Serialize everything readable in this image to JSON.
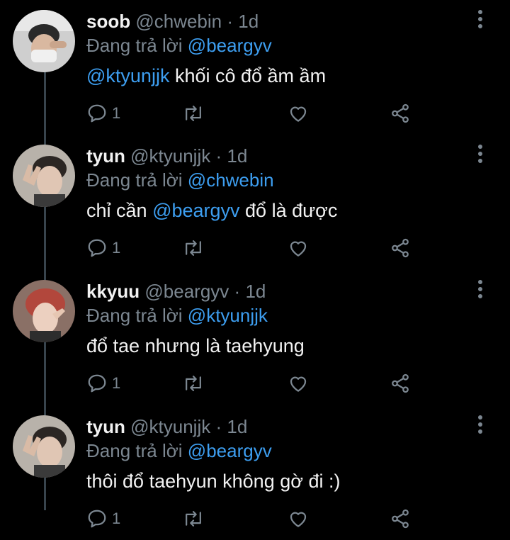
{
  "reply_prefix": "Đang trả lời",
  "colors": {
    "background": "#000000",
    "text": "#f2f2f2",
    "muted": "#7c8791",
    "mention": "#3d9ef0",
    "thread_line": "#38444d"
  },
  "action_icons": [
    "reply-icon",
    "retweet-icon",
    "like-icon",
    "share-icon"
  ],
  "tweets": [
    {
      "name": "soob",
      "handle": "@chwebin",
      "separator": "·",
      "time": "1d",
      "reply_to": "@beargyv",
      "text_parts": [
        "@ktyunjjk",
        " khối cô đổ ầm ầm"
      ],
      "reply_count": "1"
    },
    {
      "name": "tyun",
      "handle": "@ktyunjjk",
      "separator": "·",
      "time": "1d",
      "reply_to": "@chwebin",
      "text_parts": [
        "chỉ cần ",
        "@beargyv",
        " đổ là được"
      ],
      "reply_count": "1"
    },
    {
      "name": "kkyuu",
      "handle": "@beargyv",
      "separator": "·",
      "time": "1d",
      "reply_to": "@ktyunjjk",
      "text_parts": [
        "đổ tae nhưng là taehyung"
      ],
      "reply_count": "1"
    },
    {
      "name": "tyun",
      "handle": "@ktyunjjk",
      "separator": "·",
      "time": "1d",
      "reply_to": "@beargyv",
      "text_parts": [
        "thôi đổ taehyun không gờ đi :)"
      ],
      "reply_count": "1"
    }
  ]
}
